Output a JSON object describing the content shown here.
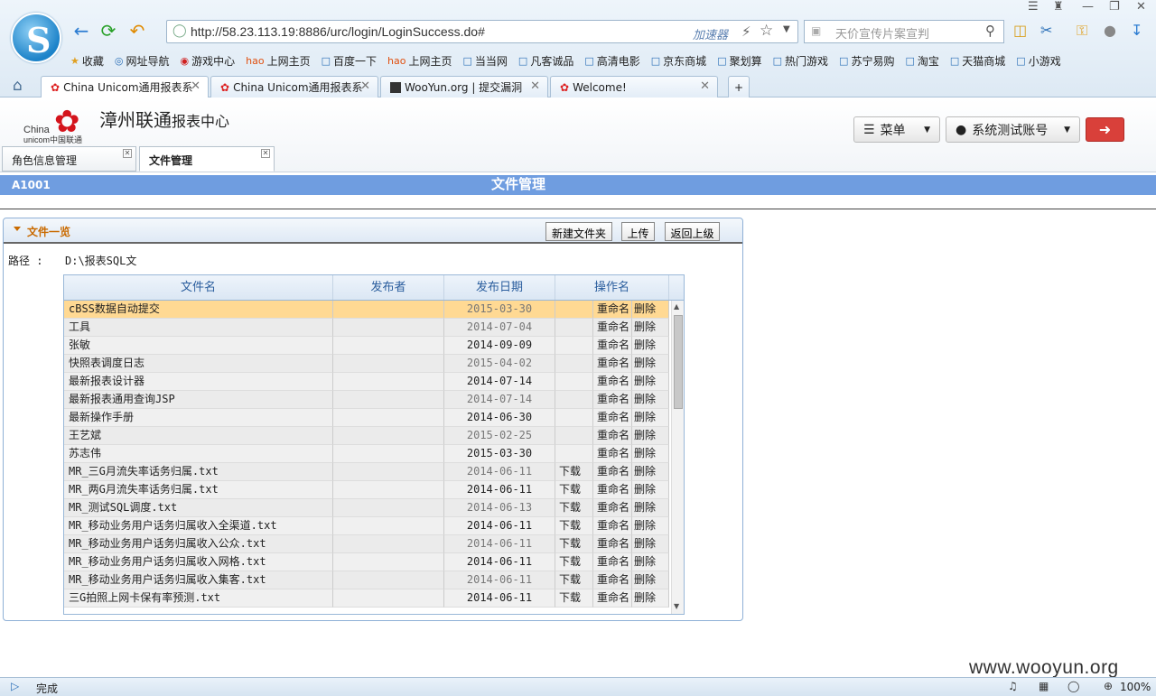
{
  "browser": {
    "url": "http://58.23.113.19:8886/urc/login/LoginSuccess.do#",
    "accelerator_label": "加速器",
    "search_placeholder": "天价宣传片案宣判",
    "bookmarks": [
      "收藏",
      "网址导航",
      "游戏中心",
      "上网主页",
      "百度一下",
      "上网主页",
      "当当网",
      "凡客诚品",
      "高清电影",
      "京东商城",
      "聚划算",
      "热门游戏",
      "苏宁易购",
      "淘宝",
      "天猫商城",
      "小游戏"
    ],
    "tabs": [
      {
        "title": "China Unicom通用报表系"
      },
      {
        "title": "China Unicom通用报表系"
      },
      {
        "title": "WooYun.org | 提交漏洞"
      },
      {
        "title": "Welcome!"
      }
    ],
    "status": "完成",
    "zoom": "100%",
    "watermark": "www.wooyun.org"
  },
  "app": {
    "brand_en_1": "China",
    "brand_en_2": "unicom中国联通",
    "brand_title": "漳州联通",
    "brand_sub": "报表中心",
    "menu_label": "菜单",
    "account_label": "系统测试账号",
    "page_tabs": [
      {
        "label": "角色信息管理"
      },
      {
        "label": "文件管理"
      }
    ],
    "page_code": "A1001",
    "page_title": "文件管理"
  },
  "panel": {
    "title": "文件一览",
    "btn_new_folder": "新建文件夹",
    "btn_upload": "上传",
    "btn_back": "返回上级",
    "path_label": "路径 :",
    "path_value": "D:\\报表SQL文"
  },
  "grid": {
    "headers": {
      "name": "文件名",
      "publisher": "发布者",
      "date": "发布日期",
      "ops": "操作名"
    },
    "rows": [
      {
        "name": "cBSS数据自动提交",
        "date": "2015-03-30",
        "dl": "",
        "rn": "重命名",
        "del": "删除"
      },
      {
        "name": "工具",
        "date": "2014-07-04",
        "dl": "",
        "rn": "重命名",
        "del": "删除"
      },
      {
        "name": "张敏",
        "date": "2014-09-09",
        "dl": "",
        "rn": "重命名",
        "del": "删除"
      },
      {
        "name": "快照表调度日志",
        "date": "2015-04-02",
        "dl": "",
        "rn": "重命名",
        "del": "删除"
      },
      {
        "name": "最新报表设计器",
        "date": "2014-07-14",
        "dl": "",
        "rn": "重命名",
        "del": "删除"
      },
      {
        "name": "最新报表通用查询JSP",
        "date": "2014-07-14",
        "dl": "",
        "rn": "重命名",
        "del": "删除"
      },
      {
        "name": "最新操作手册",
        "date": "2014-06-30",
        "dl": "",
        "rn": "重命名",
        "del": "删除"
      },
      {
        "name": "王艺斌",
        "date": "2015-02-25",
        "dl": "",
        "rn": "重命名",
        "del": "删除"
      },
      {
        "name": "苏志伟",
        "date": "2015-03-30",
        "dl": "",
        "rn": "重命名",
        "del": "删除"
      },
      {
        "name": "MR_三G月流失率话务归属.txt",
        "date": "2014-06-11",
        "dl": "下载",
        "rn": "重命名",
        "del": "删除"
      },
      {
        "name": "MR_两G月流失率话务归属.txt",
        "date": "2014-06-11",
        "dl": "下载",
        "rn": "重命名",
        "del": "删除"
      },
      {
        "name": "MR_测试SQL调度.txt",
        "date": "2014-06-13",
        "dl": "下载",
        "rn": "重命名",
        "del": "删除"
      },
      {
        "name": "MR_移动业务用户话务归属收入全渠道.txt",
        "date": "2014-06-11",
        "dl": "下载",
        "rn": "重命名",
        "del": "删除"
      },
      {
        "name": "MR_移动业务用户话务归属收入公众.txt",
        "date": "2014-06-11",
        "dl": "下载",
        "rn": "重命名",
        "del": "删除"
      },
      {
        "name": "MR_移动业务用户话务归属收入网格.txt",
        "date": "2014-06-11",
        "dl": "下载",
        "rn": "重命名",
        "del": "删除"
      },
      {
        "name": "MR_移动业务用户话务归属收入集客.txt",
        "date": "2014-06-11",
        "dl": "下载",
        "rn": "重命名",
        "del": "删除"
      },
      {
        "name": "三G拍照上网卡保有率预测.txt",
        "date": "2014-06-11",
        "dl": "下载",
        "rn": "重命名",
        "del": "删除"
      }
    ]
  }
}
